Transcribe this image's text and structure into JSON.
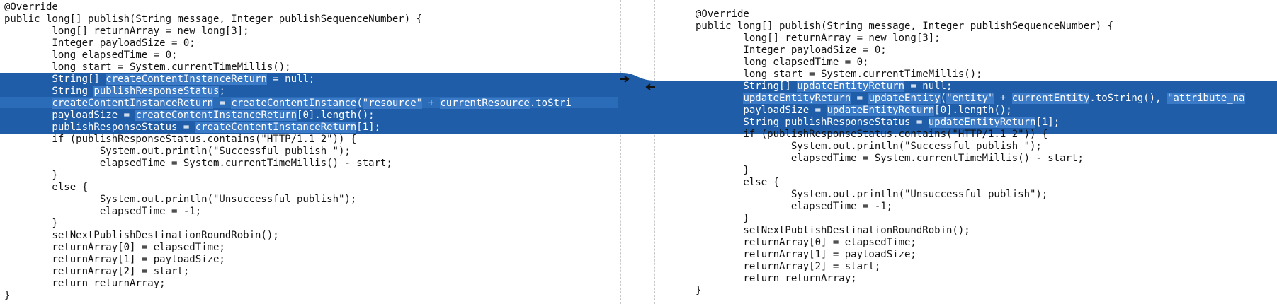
{
  "left_code": [
    "@Override",
    "public long[] publish(String message, Integer publishSequenceNumber) {",
    "        long[] returnArray = new long[3];",
    "        Integer payloadSize = 0;",
    "        long elapsedTime = 0;",
    "        long start = System.currentTimeMillis();",
    "        String[] createContentInstanceReturn = null;",
    "        String publishResponseStatus;",
    "        createContentInstanceReturn = createContentInstance(\"resource\" + currentResource.toStri",
    "        payloadSize = createContentInstanceReturn[0].length();",
    "        publishResponseStatus = createContentInstanceReturn[1];",
    "        if (publishResponseStatus.contains(\"HTTP/1.1 2\")) {",
    "                System.out.println(\"Successful publish \");",
    "                elapsedTime = System.currentTimeMillis() - start;",
    "        }",
    "        else {",
    "                System.out.println(\"Unsuccessful publish\");",
    "                elapsedTime = -1;",
    "        }",
    "        setNextPublishDestinationRoundRobin();",
    "        returnArray[0] = elapsedTime;",
    "        returnArray[1] = payloadSize;",
    "        returnArray[2] = start;",
    "        return returnArray;",
    "}"
  ],
  "right_code": [
    "@Override",
    "public long[] publish(String message, Integer publishSequenceNumber) {",
    "        long[] returnArray = new long[3];",
    "        Integer payloadSize = 0;",
    "        long elapsedTime = 0;",
    "        long start = System.currentTimeMillis();",
    "        String[] updateEntityReturn = null;",
    "        updateEntityReturn = updateEntity(\"entity\" + currentEntity.toString(), \"attribute_na",
    "        payloadSize = updateEntityReturn[0].length();",
    "        String publishResponseStatus = updateEntityReturn[1];",
    "        if (publishResponseStatus.contains(\"HTTP/1.1 2\")) {",
    "                System.out.println(\"Successful publish \");",
    "                elapsedTime = System.currentTimeMillis() - start;",
    "        }",
    "        else {",
    "                System.out.println(\"Unsuccessful publish\");",
    "                elapsedTime = -1;",
    "        }",
    "        setNextPublishDestinationRoundRobin();",
    "        returnArray[0] = elapsedTime;",
    "        returnArray[1] = payloadSize;",
    "        returnArray[2] = start;",
    "        return returnArray;",
    "}"
  ],
  "colors": {
    "background": "#ffffff",
    "text": "#121212",
    "change_highlight": "#1f5da8",
    "inline_change": "#3a7ac7",
    "text_on_highlight": "#ffffff"
  },
  "icons": {
    "copy_right": "arrow-right-icon",
    "copy_left": "arrow-left-icon"
  }
}
